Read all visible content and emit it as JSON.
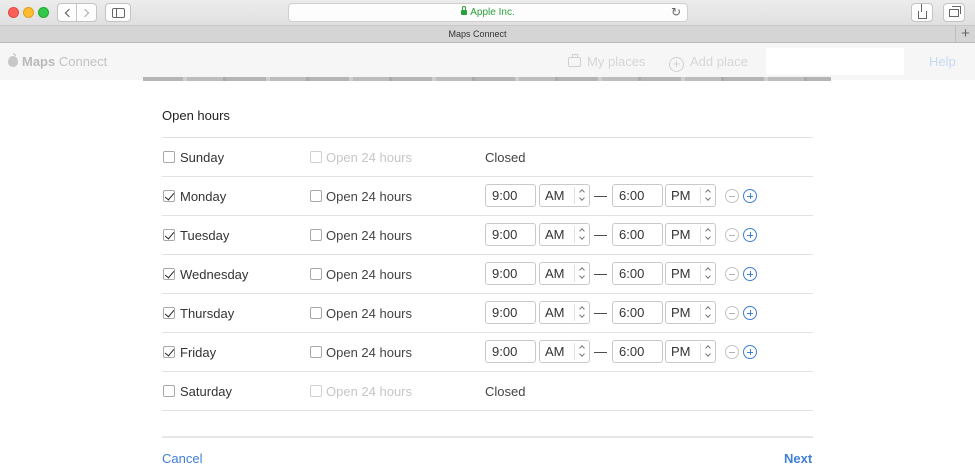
{
  "browser": {
    "url": "Apple Inc.",
    "tab_title": "Maps Connect",
    "new_tab": "+"
  },
  "header": {
    "brand_bold": "Maps",
    "brand_rest": " Connect",
    "my_places": "My places",
    "add_place": "Add place",
    "help": "Help"
  },
  "form": {
    "title": "Open hours",
    "open24_label": "Open 24 hours",
    "closed_label": "Closed",
    "dash": "—",
    "days": [
      {
        "name": "Sunday",
        "checked": false,
        "open24": false,
        "closed": true
      },
      {
        "name": "Monday",
        "checked": true,
        "open24": false,
        "open_time": "9:00",
        "open_ampm": "AM",
        "close_time": "6:00",
        "close_ampm": "PM"
      },
      {
        "name": "Tuesday",
        "checked": true,
        "open24": false,
        "open_time": "9:00",
        "open_ampm": "AM",
        "close_time": "6:00",
        "close_ampm": "PM"
      },
      {
        "name": "Wednesday",
        "checked": true,
        "open24": false,
        "open_time": "9:00",
        "open_ampm": "AM",
        "close_time": "6:00",
        "close_ampm": "PM"
      },
      {
        "name": "Thursday",
        "checked": true,
        "open24": false,
        "open_time": "9:00",
        "open_ampm": "AM",
        "close_time": "6:00",
        "close_ampm": "PM"
      },
      {
        "name": "Friday",
        "checked": true,
        "open24": false,
        "open_time": "9:00",
        "open_ampm": "AM",
        "close_time": "6:00",
        "close_ampm": "PM"
      },
      {
        "name": "Saturday",
        "checked": false,
        "open24": false,
        "closed": true
      }
    ]
  },
  "footer": {
    "cancel": "Cancel",
    "next": "Next"
  },
  "colors": {
    "link": "#3f7fd8",
    "url_green": "#2aa03a"
  }
}
